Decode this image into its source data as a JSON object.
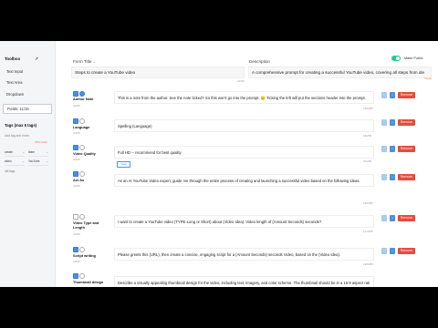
{
  "sidebar": {
    "title": "Toolbox",
    "items": [
      "Text Input",
      "Text Area",
      "Dropdown",
      "Fields: 11/15"
    ],
    "tags_title": "Tags (max 6 tags)",
    "tag_input_placeholder": "Add tag and enter",
    "tag_count": "0/50 chars",
    "tags": [
      {
        "name": "create",
        "value": "learn"
      },
      {
        "name": "video",
        "value": "YouTube"
      }
    ],
    "tags_footer": "4/6 tags"
  },
  "header": {
    "form_title_label": "Form Title",
    "form_title_value": "Steps to create a YouTube video",
    "form_title_count": "31/50",
    "description_label": "Description",
    "description_value": "A comprehensive prompt for creating a successful YouTube video, covering all steps from ide",
    "make_public_label": "Make Public",
    "toggle_on": true,
    "orange_note": "Tag(s)"
  },
  "buttons": {
    "view": "View",
    "remove": "Remove",
    "up": "↑",
    "down": "↓"
  },
  "rows": [
    {
      "label": "Author Note",
      "sub": "AIPW",
      "text": "This is a note from the author. See the note ticked? So this won't go into the prompt. 😊 Ticking the left will put the sections header into the prompt.",
      "count": "136/255",
      "checked": true
    },
    {
      "label": "Language",
      "sub": "AIPW",
      "text": "Spelling (Language)",
      "count": "19/255",
      "checked": true
    },
    {
      "label": "Video Quality",
      "sub": "AIPW",
      "text": "Full HD -- recommend for best quality",
      "count": "37/255",
      "checked": true
    },
    {
      "label": "Act As",
      "sub": "AIPW",
      "text": "As an AI YouTube Video expert, guide me through the entire process of creating and launching a successful video based on the following ideas.",
      "count": "145/255",
      "checked": true
    },
    {
      "label": "Video Type and Length",
      "sub": "AIPW",
      "text": "I want to create a YouTube video (TYPE-Long or Short) about (Video Idea). Video length of (Amount Seconds) seconds?",
      "count": "117/255",
      "checked": false
    },
    {
      "label": "Script writing",
      "sub": "AIPW",
      "text": "Please greets this (URL), then create a concise, engaging script for a (Amount Seconds) seconds Video, based on the (Video Idea).",
      "count": "130/255",
      "checked": true
    },
    {
      "label": "Thumbnail design",
      "sub": "AIPW",
      "text": "Describe a visually appealing thumbnail design for the video, including text, imagery, and color scheme. The thumbnail should be in a 16:9 aspect rati",
      "count": "150/255",
      "checked": true
    }
  ]
}
